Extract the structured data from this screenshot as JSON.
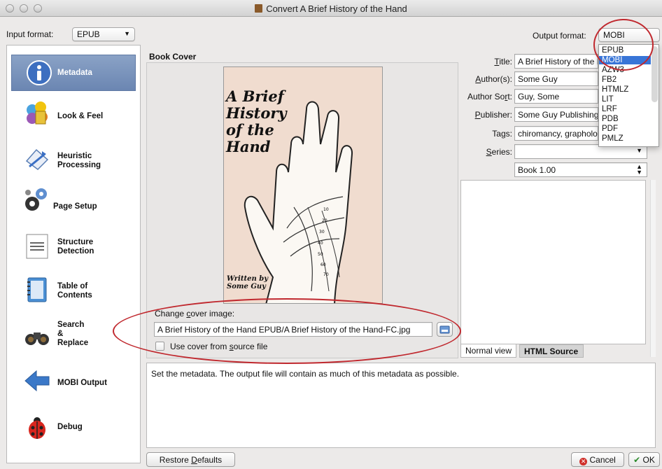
{
  "window": {
    "title": "Convert A Brief History of the Hand"
  },
  "input_format": {
    "label": "Input format:",
    "value": "EPUB"
  },
  "output_format": {
    "label": "Output format:",
    "value": "MOBI",
    "options": [
      "EPUB",
      "MOBI",
      "AZW3",
      "FB2",
      "HTMLZ",
      "LIT",
      "LRF",
      "PDB",
      "PDF",
      "PMLZ"
    ],
    "selected": "MOBI"
  },
  "sidebar": {
    "items": [
      {
        "label": "Metadata",
        "icon": "info-icon",
        "active": true
      },
      {
        "label": "Look & Feel",
        "icon": "paint-palette-icon"
      },
      {
        "label": "Heuristic Processing",
        "icon": "heuristics-icon"
      },
      {
        "label": "Page Setup",
        "icon": "gears-icon"
      },
      {
        "label": "Structure Detection",
        "icon": "document-icon"
      },
      {
        "label": "Table of Contents",
        "icon": "notebook-icon"
      },
      {
        "label": "Search & Replace",
        "icon": "binoculars-icon"
      },
      {
        "label": "MOBI Output",
        "icon": "arrow-left-icon"
      },
      {
        "label": "Debug",
        "icon": "ladybug-icon"
      }
    ]
  },
  "book_cover": {
    "group_title": "Book Cover",
    "cover_title": "A Brief History of the Hand",
    "cover_byline": "Written by Some Guy",
    "change_label": "Change cover image:",
    "path": "A Brief History of the Hand EPUB/A Brief History of the Hand-FC.jpg",
    "use_source_label": "Use cover from source file",
    "use_source_checked": false
  },
  "metadata": {
    "title_label": "Title:",
    "title_value": "A Brief History of the Hand",
    "authors_label": "Author(s):",
    "authors_value": "Some Guy",
    "author_sort_label": "Author Sort:",
    "author_sort_value": "Guy, Some",
    "publisher_label": "Publisher:",
    "publisher_value": "Some Guy Publishing",
    "tags_label": "Tags:",
    "tags_value": "chiromancy, graphology",
    "series_label": "Series:",
    "series_value": "",
    "series_index": "Book 1.00"
  },
  "comments_tabs": {
    "normal": "Normal view",
    "html": "HTML Source",
    "active": "Normal view"
  },
  "description": "Set the metadata. The output file will contain as much of this metadata as possible.",
  "buttons": {
    "restore": "Restore Defaults",
    "cancel": "Cancel",
    "ok": "OK"
  },
  "colors": {
    "annotation": "#c0282e",
    "selection": "#3875d7",
    "sidebar_active": "#7891bb"
  }
}
